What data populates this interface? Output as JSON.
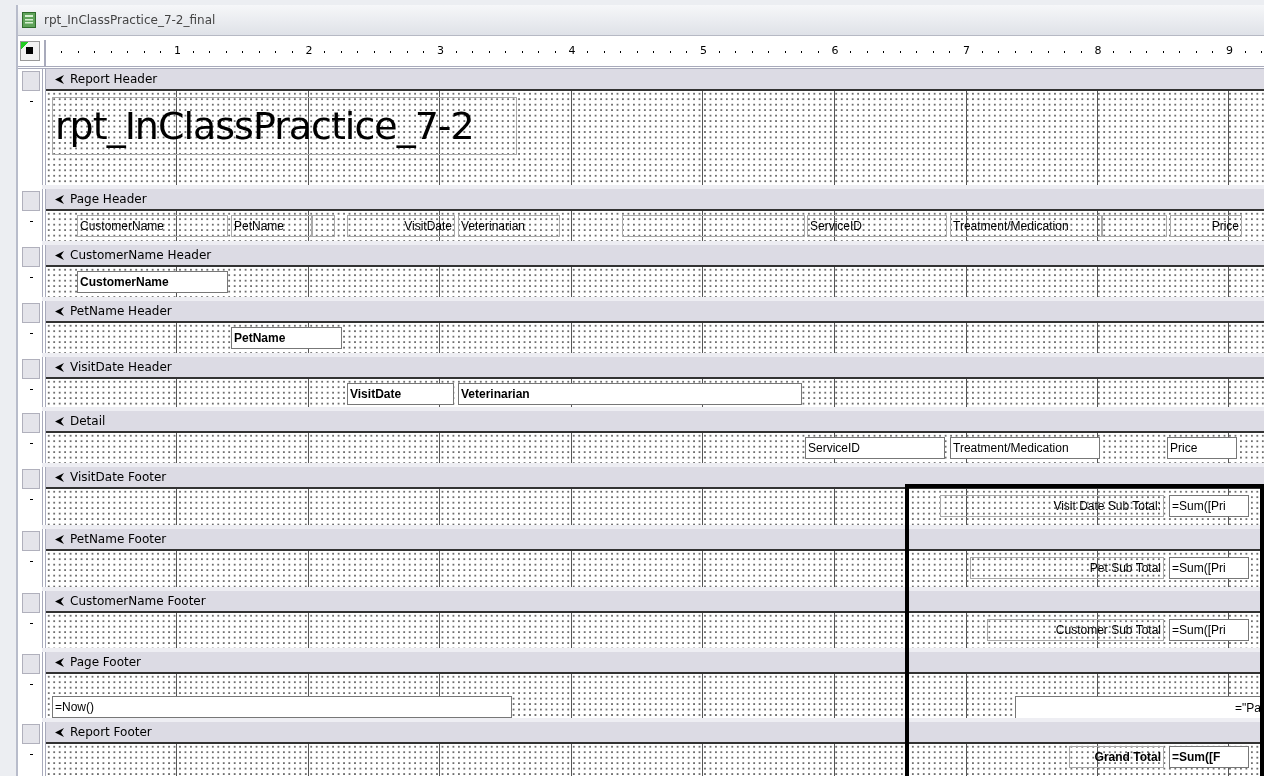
{
  "window": {
    "title": "rpt_InClassPractice_7-2_final"
  },
  "ruler": {
    "labels": [
      "1",
      "2",
      "3",
      "4",
      "5",
      "6",
      "7",
      "8",
      "9"
    ]
  },
  "sections": [
    {
      "name": "Report Header",
      "controls": [
        {
          "kind": "title",
          "text": "rpt_InClassPractice_7-2",
          "bold": false
        }
      ]
    },
    {
      "name": "Page Header",
      "controls": [
        {
          "kind": "label",
          "text": "CustomerName",
          "bold": false
        },
        {
          "kind": "label",
          "text": "PetName",
          "bold": false
        },
        {
          "kind": "empty"
        },
        {
          "kind": "label",
          "text": "VisitDate",
          "bold": false
        },
        {
          "kind": "label",
          "text": "Veterinarian",
          "bold": false
        },
        {
          "kind": "empty"
        },
        {
          "kind": "label",
          "text": "ServiceID",
          "bold": false
        },
        {
          "kind": "label",
          "text": "Treatment/Medication",
          "bold": false
        },
        {
          "kind": "empty"
        },
        {
          "kind": "label",
          "text": "Price",
          "bold": false
        }
      ]
    },
    {
      "name": "CustomerName Header",
      "controls": [
        {
          "kind": "textbox",
          "text": "CustomerName",
          "bold": true
        }
      ]
    },
    {
      "name": "PetName Header",
      "controls": [
        {
          "kind": "textbox",
          "text": "PetName",
          "bold": true
        }
      ]
    },
    {
      "name": "VisitDate Header",
      "controls": [
        {
          "kind": "textbox",
          "text": "VisitDate",
          "bold": true
        },
        {
          "kind": "textbox",
          "text": "Veterinarian",
          "bold": true
        }
      ]
    },
    {
      "name": "Detail",
      "controls": [
        {
          "kind": "textbox",
          "text": "ServiceID",
          "bold": false
        },
        {
          "kind": "textbox",
          "text": "Treatment/Medication",
          "bold": false
        },
        {
          "kind": "textbox",
          "text": "Price",
          "bold": false
        }
      ]
    },
    {
      "name": "VisitDate Footer",
      "controls": [
        {
          "kind": "label",
          "text": "Visit Date Sub Total:",
          "bold": false
        },
        {
          "kind": "textbox",
          "text": "=Sum([Pri",
          "bold": false
        }
      ]
    },
    {
      "name": "PetName Footer",
      "controls": [
        {
          "kind": "label",
          "text": "Pet Sub Total",
          "bold": false
        },
        {
          "kind": "textbox",
          "text": "=Sum([Pri",
          "bold": false
        }
      ]
    },
    {
      "name": "CustomerName Footer",
      "controls": [
        {
          "kind": "label",
          "text": "Customer Sub Total",
          "bold": false
        },
        {
          "kind": "textbox",
          "text": "=Sum([Pri",
          "bold": false
        }
      ]
    },
    {
      "name": "Page Footer",
      "controls": [
        {
          "kind": "textbox",
          "text": "=Now()",
          "bold": false
        },
        {
          "kind": "textbox",
          "text": "=\"Pa",
          "bold": false
        }
      ]
    },
    {
      "name": "Report Footer",
      "controls": [
        {
          "kind": "label",
          "text": "Grand Total",
          "bold": true
        },
        {
          "kind": "textbox",
          "text": "=Sum([F",
          "bold": true
        }
      ]
    }
  ]
}
